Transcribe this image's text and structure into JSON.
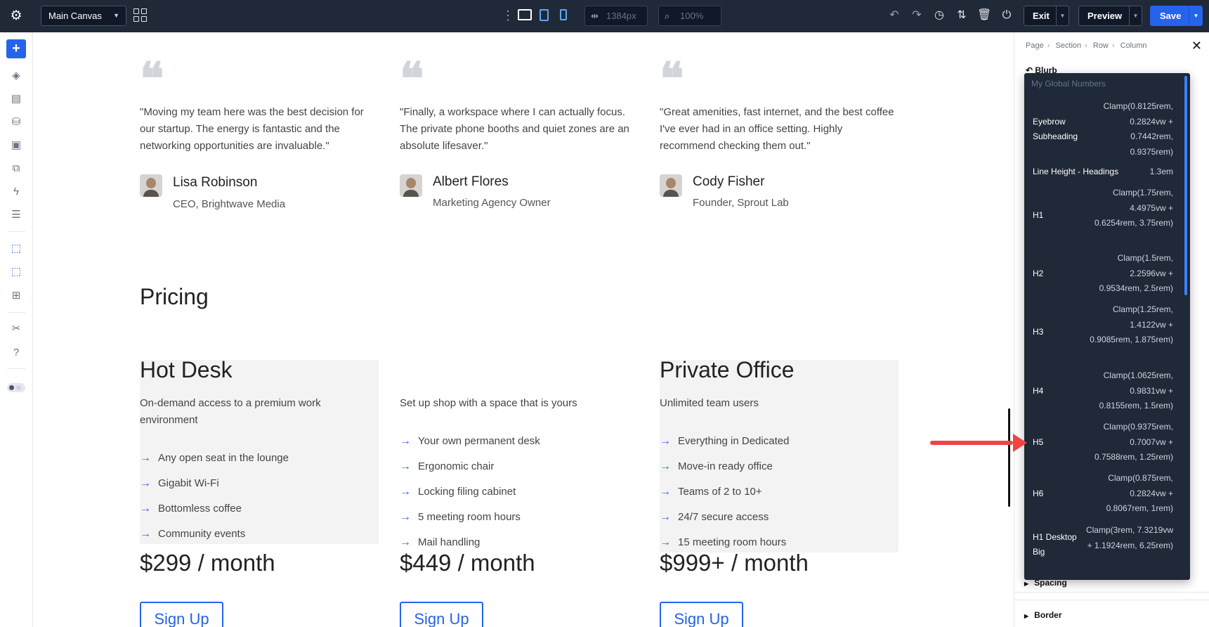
{
  "topbar": {
    "canvas_select": "Main Canvas",
    "width_value": "1384px",
    "zoom_value": "100%",
    "exit_label": "Exit",
    "preview_label": "Preview",
    "save_label": "Save"
  },
  "testimonials": [
    {
      "quote": "\"Moving my team here was the best decision for our startup. The energy is fantastic and the networking opportunities are invaluable.\"",
      "name": "Lisa Robinson",
      "role": "CEO, Brightwave Media"
    },
    {
      "quote": "\"Finally, a workspace where I can actually focus. The private phone booths and quiet zones are an absolute lifesaver.\"",
      "name": "Albert Flores",
      "role": "Marketing Agency Owner"
    },
    {
      "quote": "\"Great amenities, fast internet, and the best coffee I've ever had in an office setting. Highly recommend checking them out.\"",
      "name": "Cody Fisher",
      "role": "Founder, Sprout Lab"
    }
  ],
  "pricing": {
    "title": "Pricing",
    "arrow_glyph": "→",
    "plans": [
      {
        "title": "Hot Desk",
        "desc": "On-demand access to a premium work environment",
        "features": [
          "Any open seat in the lounge",
          "Gigabit Wi-Fi",
          "Bottomless coffee",
          "Community events"
        ],
        "price": "$299 / month",
        "cta": "Sign Up"
      },
      {
        "title": "",
        "desc": "Set up shop with a space that is yours",
        "features": [
          "Your own permanent desk",
          "Ergonomic chair",
          "Locking filing cabinet",
          "5 meeting room hours",
          "Mail handling"
        ],
        "price": "$449 / month",
        "cta": "Sign Up"
      },
      {
        "title": "Private Office",
        "desc": "Unlimited team users",
        "features": [
          "Everything in Dedicated",
          "Move-in ready office",
          "Teams of 2 to 10+",
          "24/7 secure access",
          "15 meeting room hours"
        ],
        "price": "$999+ / month",
        "cta": "Sign Up"
      }
    ]
  },
  "panel": {
    "breadcrumb": [
      "Page",
      "Section",
      "Row",
      "Column"
    ],
    "module": "Blurb",
    "sections": [
      "Spacing",
      "Border"
    ],
    "dropdown": {
      "header": "My Global Numbers",
      "items": [
        {
          "label": "Eyebrow Subheading",
          "value": "Clamp(0.8125rem, 0.2824vw + 0.7442rem, 0.9375rem)"
        },
        {
          "label": "Line Height - Headings",
          "value": "1.3em"
        },
        {
          "label": "H1",
          "value": "Clamp(1.75rem, 4.4975vw + 0.6254rem, 3.75rem)"
        },
        {
          "label": "H2",
          "value": "Clamp(1.5rem, 2.2596vw + 0.9534rem, 2.5rem)"
        },
        {
          "label": "H3",
          "value": "Clamp(1.25rem, 1.4122vw + 0.9085rem, 1.875rem)"
        },
        {
          "label": "H4",
          "value": "Clamp(1.0625rem, 0.9831vw + 0.8155rem, 1.5rem)"
        },
        {
          "label": "H5",
          "value": "Clamp(0.9375rem, 0.7007vw + 0.7588rem, 1.25rem)"
        },
        {
          "label": "H6",
          "value": "Clamp(0.875rem, 0.2824vw + 0.8067rem, 1rem)"
        },
        {
          "label": "H1 Desktop Big",
          "value": "Clamp(3rem, 7.3219vw + 1.1924rem, 6.25rem)"
        }
      ]
    }
  },
  "colors": {
    "accent": "#2563eb",
    "topbar": "#1f2937",
    "highlight_arrow": "#ef4444"
  }
}
